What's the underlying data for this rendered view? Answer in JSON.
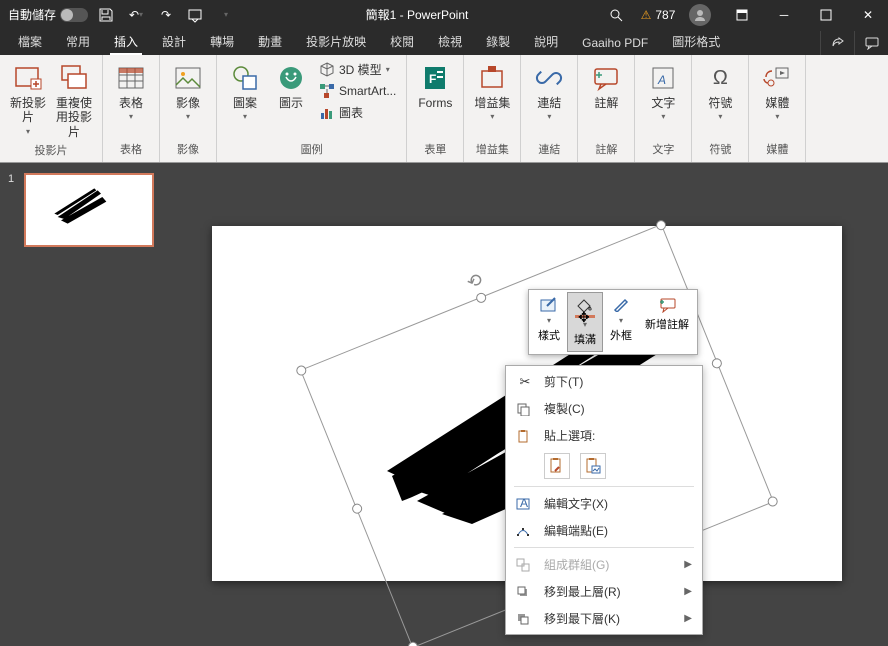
{
  "title": "簡報1 - PowerPoint",
  "autosave_label": "自動儲存",
  "autosave_state": "關閉",
  "warn_count": "787",
  "tabs": [
    "檔案",
    "常用",
    "插入",
    "設計",
    "轉場",
    "動畫",
    "投影片放映",
    "校閱",
    "檢視",
    "錄製",
    "說明",
    "Gaaiho PDF",
    "圖形格式"
  ],
  "active_tab": 2,
  "ribbon": {
    "slides": {
      "label": "投影片",
      "new_slide": "新投影片",
      "reuse": "重複使用投影片"
    },
    "tables": {
      "label": "表格",
      "btn": "表格"
    },
    "images": {
      "label": "影像",
      "btn": "影像"
    },
    "illust": {
      "label": "圖例",
      "shapes": "圖案",
      "icons": "圖示",
      "model3d": "3D 模型",
      "smartart": "SmartArt...",
      "chart": "圖表"
    },
    "forms": {
      "label": "表單",
      "btn": "Forms"
    },
    "addins": {
      "label": "增益集",
      "btn": "增益集"
    },
    "links": {
      "label": "連結",
      "btn": "連結"
    },
    "comments": {
      "label": "註解",
      "btn": "註解"
    },
    "text": {
      "label": "文字",
      "btn": "文字"
    },
    "symbols": {
      "label": "符號",
      "btn": "符號"
    },
    "media": {
      "label": "媒體",
      "btn": "媒體"
    }
  },
  "slide_number": "1",
  "mini_toolbar": {
    "style": "樣式",
    "fill": "填滿",
    "outline": "外框",
    "new_comment": "新增註解"
  },
  "context_menu": {
    "cut": "剪下(T)",
    "copy": "複製(C)",
    "paste_opts": "貼上選項:",
    "edit_text": "編輯文字(X)",
    "edit_points": "編輯端點(E)",
    "group": "組成群組(G)",
    "bring_front": "移到最上層(R)",
    "send_back": "移到最下層(K)"
  }
}
